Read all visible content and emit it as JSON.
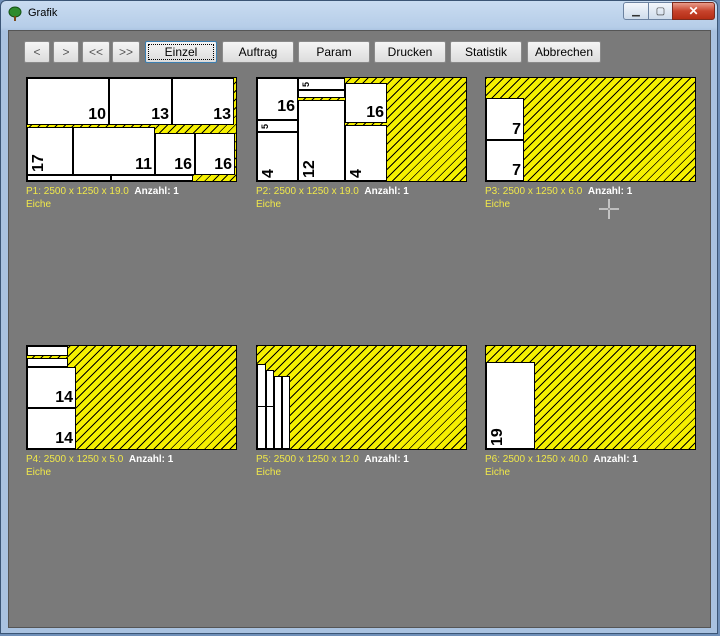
{
  "window": {
    "title": "Grafik"
  },
  "toolbar": {
    "prev": "<",
    "next": ">",
    "first": "<<",
    "last": ">>",
    "einzel": "Einzel",
    "auftrag": "Auftrag",
    "param": "Param",
    "drucken": "Drucken",
    "statistik": "Statistik",
    "abbrechen": "Abbrechen"
  },
  "panels": [
    {
      "label": "P1: 2500 x 1250 x 19.0",
      "count_label": "Anzahl: 1",
      "material": "Eiche"
    },
    {
      "label": "P2: 2500 x 1250 x 19.0",
      "count_label": "Anzahl: 1",
      "material": "Eiche"
    },
    {
      "label": "P3: 2500 x 1250 x 6.0",
      "count_label": "Anzahl: 1",
      "material": "Eiche"
    },
    {
      "label": "P4: 2500 x 1250 x 5.0",
      "count_label": "Anzahl: 1",
      "material": "Eiche"
    },
    {
      "label": "P5: 2500 x 1250 x 12.0",
      "count_label": "Anzahl: 1",
      "material": "Eiche"
    },
    {
      "label": "P6: 2500 x 1250 x 40.0",
      "count_label": "Anzahl: 1",
      "material": "Eiche"
    }
  ],
  "parts": {
    "p1": [
      "10",
      "13",
      "13",
      "17",
      "11",
      "16",
      "16"
    ],
    "p2": [
      "16",
      "5",
      "5",
      "16",
      "4",
      "12",
      "4"
    ],
    "p3": [
      "7",
      "7"
    ],
    "p4": [
      "14",
      "14"
    ],
    "p6": [
      "19"
    ]
  },
  "colors": {
    "waste": "#f5f000",
    "background": "#7a7a7a",
    "caption": "#f0e84a"
  }
}
